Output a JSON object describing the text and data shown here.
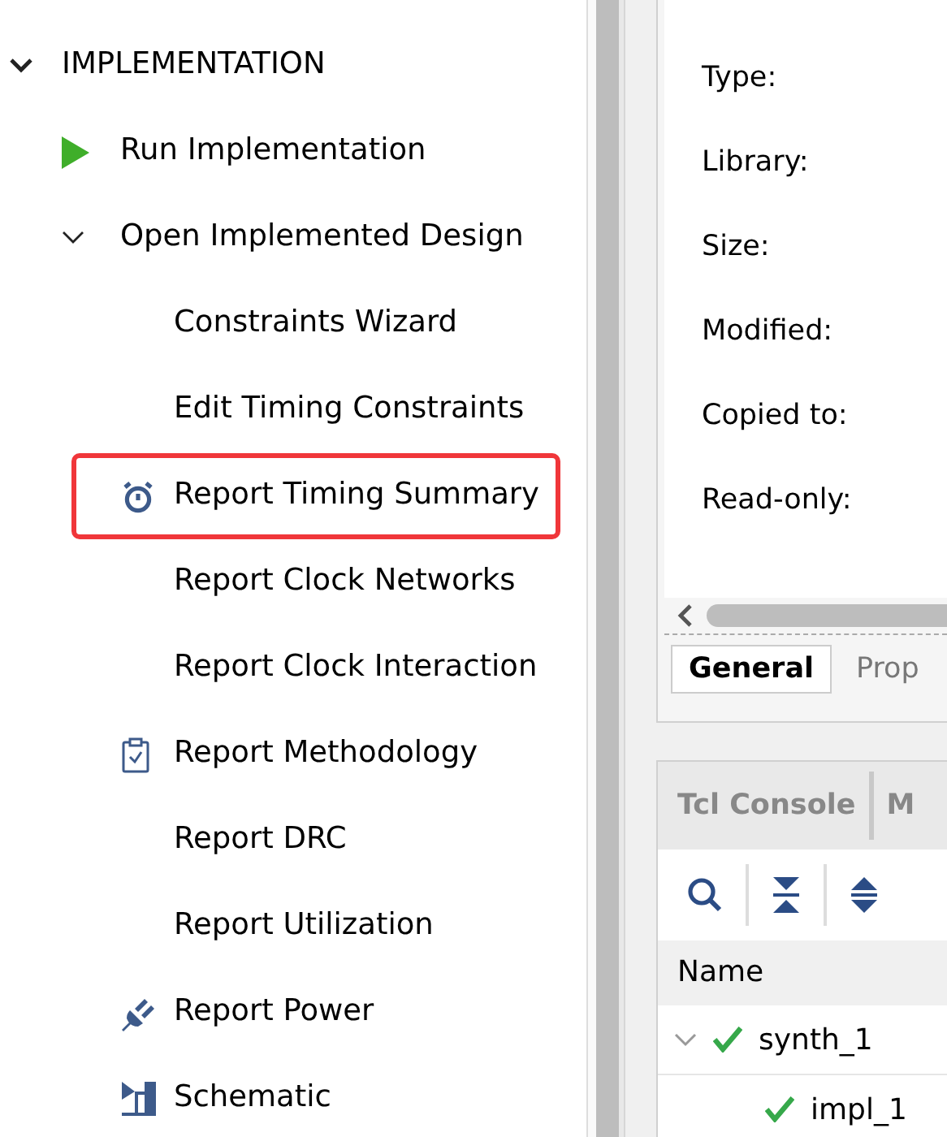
{
  "flow_navigator": {
    "sections": [
      {
        "label": "IMPLEMENTATION",
        "expanded": true,
        "children": [
          {
            "label": "Run Implementation",
            "kind": "run"
          },
          {
            "label": "Open Implemented Design",
            "expanded": true,
            "children": [
              {
                "label": "Constraints Wizard",
                "kind": "plain",
                "highlighted": false
              },
              {
                "label": "Edit Timing Constraints",
                "kind": "plain",
                "highlighted": false
              },
              {
                "label": "Report Timing Summary",
                "kind": "timer",
                "highlighted": true
              },
              {
                "label": "Report Clock Networks",
                "kind": "plain",
                "highlighted": false
              },
              {
                "label": "Report Clock Interaction",
                "kind": "plain",
                "highlighted": false
              },
              {
                "label": "Report Methodology",
                "kind": "clipboard",
                "highlighted": false
              },
              {
                "label": "Report DRC",
                "kind": "plain",
                "highlighted": false
              },
              {
                "label": "Report Utilization",
                "kind": "plain",
                "highlighted": false
              },
              {
                "label": "Report Power",
                "kind": "plug",
                "highlighted": false
              },
              {
                "label": "Schematic",
                "kind": "schematic",
                "highlighted": false
              }
            ]
          }
        ]
      }
    ]
  },
  "properties": {
    "fields": [
      "Type:",
      "Library:",
      "Size:",
      "Modified:",
      "Copied to:",
      "Read-only:"
    ],
    "tabs": [
      {
        "label": "General",
        "selected": true
      },
      {
        "label": "Prop",
        "selected": false
      }
    ]
  },
  "console": {
    "tabs": [
      {
        "label": "Tcl Console",
        "selected": false
      },
      {
        "label": "M",
        "selected": false
      }
    ],
    "column": "Name",
    "runs": [
      {
        "name": "synth_1",
        "expanded": true,
        "done": true,
        "children": [
          {
            "name": "impl_1",
            "done": true
          }
        ]
      }
    ]
  }
}
